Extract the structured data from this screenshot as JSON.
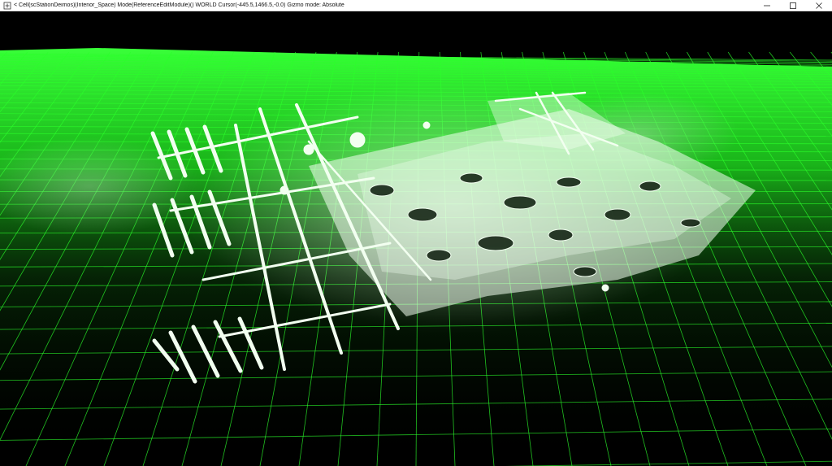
{
  "window": {
    "title": "< Cell(scStationDeimos)(Interior_Space) Mode(ReferenceEditModule)() WORLD  Cursor(-445.5,1466.5,-0.0)  Gizmo mode: Absolute",
    "controls": {
      "minimize_icon": "minimize-icon",
      "maximize_icon": "maximize-icon",
      "close_icon": "close-icon"
    }
  },
  "viewport": {
    "grid_color": "#2bff2b",
    "background_color": "#000000",
    "structure_color": "#f2fff0"
  }
}
